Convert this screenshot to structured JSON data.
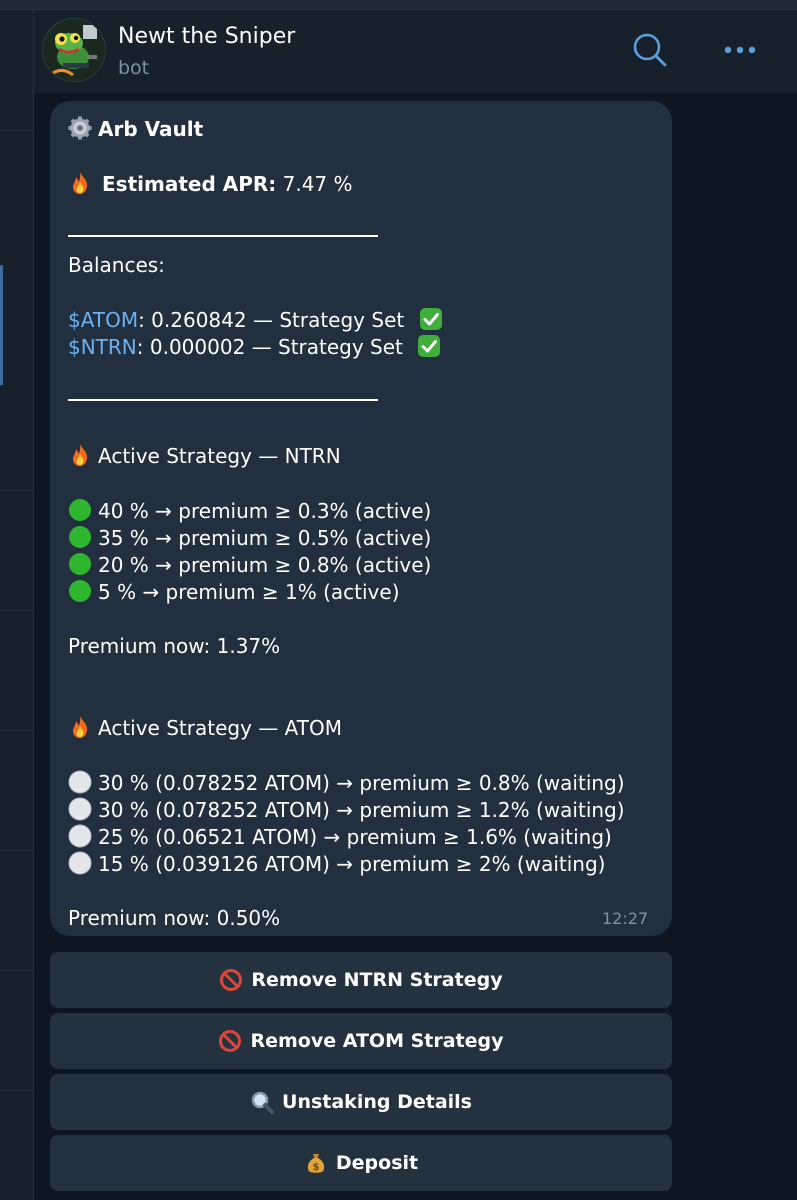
{
  "header": {
    "title": "Newt the Sniper",
    "subtitle": "bot"
  },
  "message": {
    "vault_title": "Arb Vault",
    "apr_label": "Estimated APR:",
    "apr_value": "7.47 %",
    "balances_label": "Balances:",
    "balances": [
      {
        "ticker": "$ATOM",
        "text": ": 0.260842 — Strategy Set"
      },
      {
        "ticker": "$NTRN",
        "text": ": 0.000002 — Strategy Set"
      }
    ],
    "ntrn": {
      "heading": "Active Strategy — NTRN",
      "tiers": [
        "40 % → premium ≥ 0.3%   (active)",
        "35 % → premium ≥ 0.5%   (active)",
        "20 % → premium ≥ 0.8%   (active)",
        "5 % → premium ≥ 1%   (active)"
      ],
      "premium_now": "Premium now: 1.37%"
    },
    "atom": {
      "heading": "Active Strategy — ATOM",
      "tiers": [
        "30 %  (0.078252 ATOM) → premium ≥ 0.8% (waiting)",
        "30 %  (0.078252 ATOM) → premium ≥ 1.2% (waiting)",
        "25 %  (0.06521 ATOM) → premium ≥ 1.6% (waiting)",
        "15 %  (0.039126 ATOM) → premium ≥ 2% (waiting)"
      ],
      "premium_now": "Premium now: 0.50%"
    },
    "time": "12:27"
  },
  "buttons": {
    "remove_ntrn": "Remove NTRN Strategy",
    "remove_atom": "Remove ATOM Strategy",
    "unstaking": "Unstaking Details",
    "deposit": "Deposit"
  },
  "colors": {
    "accent": "#6ab2f2",
    "active_dot": "#2fb62f",
    "bubble": "#212f3f",
    "chat_bg": "#0e1621"
  },
  "icons": [
    "gear-icon",
    "fire-icon",
    "check-mark-icon",
    "green-circle-icon",
    "white-circle-icon",
    "no-entry-icon",
    "magnifier-icon",
    "money-bag-icon",
    "search-icon",
    "more-icon"
  ]
}
